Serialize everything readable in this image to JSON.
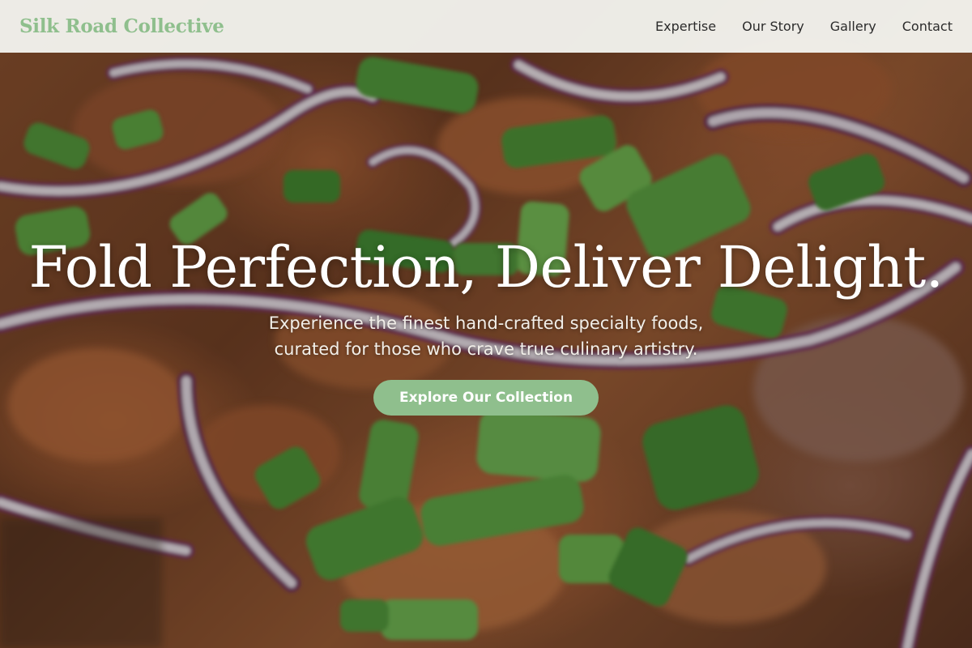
{
  "header": {
    "brand": "Silk Road Collective",
    "nav": [
      {
        "label": "Expertise"
      },
      {
        "label": "Our Story"
      },
      {
        "label": "Gallery"
      },
      {
        "label": "Contact"
      }
    ]
  },
  "hero": {
    "title": "Fold Perfection, Deliver Delight.",
    "subtitle_line1": "Experience the finest hand-crafted specialty foods,",
    "subtitle_line2": "curated for those who crave true culinary artistry.",
    "cta_label": "Explore Our Collection",
    "background_image": "blurred close-up of dish with red onion rings and green scallions"
  },
  "colors": {
    "brand": "#8fbf8d",
    "nav_text": "#2b2b2b",
    "hero_text": "#ffffff"
  }
}
